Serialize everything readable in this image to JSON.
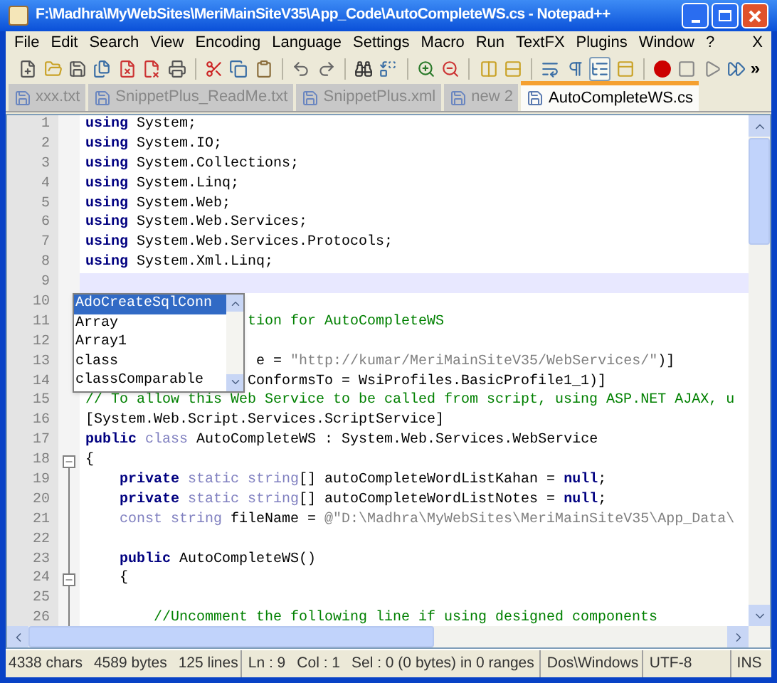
{
  "window": {
    "title": "F:\\Madhra\\MyWebSites\\MeriMainSiteV35\\App_Code\\AutoCompleteWS.cs - Notepad++"
  },
  "menu": {
    "items": [
      "File",
      "Edit",
      "Search",
      "View",
      "Encoding",
      "Language",
      "Settings",
      "Macro",
      "Run",
      "TextFX",
      "Plugins",
      "Window",
      "?"
    ],
    "close": "X"
  },
  "toolbar": {
    "buttons": [
      {
        "pressed": false
      },
      {
        "pressed": false
      },
      {
        "pressed": false
      },
      {
        "pressed": false
      },
      {
        "pressed": false
      },
      {
        "pressed": false
      },
      {
        "pressed": false
      },
      {
        "pressed": false
      },
      {
        "pressed": false
      },
      {
        "pressed": false
      },
      {
        "pressed": false
      },
      {
        "pressed": false
      },
      {
        "pressed": false
      },
      {
        "pressed": false
      },
      {
        "pressed": false
      },
      {
        "pressed": false
      },
      {
        "pressed": false
      },
      {
        "pressed": false
      },
      {
        "pressed": false
      },
      {
        "pressed": false
      },
      {
        "pressed": true
      },
      {
        "pressed": false
      },
      {
        "pressed": false
      },
      {
        "pressed": false
      },
      {
        "pressed": false
      },
      {
        "pressed": false
      }
    ],
    "overflow": "»"
  },
  "tabs": [
    {
      "label": "xxx.txt",
      "selected": false
    },
    {
      "label": "SnippetPlus_ReadMe.txt",
      "selected": false
    },
    {
      "label": "SnippetPlus.xml",
      "selected": false
    },
    {
      "label": "new  2",
      "selected": false
    },
    {
      "label": "AutoCompleteWS.cs",
      "selected": true
    }
  ],
  "editor": {
    "lines": [
      {
        "number": "1",
        "current": false,
        "fold_start": false,
        "segments": [
          {
            "kind": "keyword",
            "text": "using"
          },
          {
            "kind": "plain",
            "text": " System;"
          }
        ]
      },
      {
        "number": "2",
        "current": false,
        "fold_start": false,
        "segments": [
          {
            "kind": "keyword",
            "text": "using"
          },
          {
            "kind": "plain",
            "text": " System.IO;"
          }
        ]
      },
      {
        "number": "3",
        "current": false,
        "fold_start": false,
        "segments": [
          {
            "kind": "keyword",
            "text": "using"
          },
          {
            "kind": "plain",
            "text": " System.Collections;"
          }
        ]
      },
      {
        "number": "4",
        "current": false,
        "fold_start": false,
        "segments": [
          {
            "kind": "keyword",
            "text": "using"
          },
          {
            "kind": "plain",
            "text": " System.Linq;"
          }
        ]
      },
      {
        "number": "5",
        "current": false,
        "fold_start": false,
        "segments": [
          {
            "kind": "keyword",
            "text": "using"
          },
          {
            "kind": "plain",
            "text": " System.Web;"
          }
        ]
      },
      {
        "number": "6",
        "current": false,
        "fold_start": false,
        "segments": [
          {
            "kind": "keyword",
            "text": "using"
          },
          {
            "kind": "plain",
            "text": " System.Web.Services;"
          }
        ]
      },
      {
        "number": "7",
        "current": false,
        "fold_start": false,
        "segments": [
          {
            "kind": "keyword",
            "text": "using"
          },
          {
            "kind": "plain",
            "text": " System.Web.Services.Protocols;"
          }
        ]
      },
      {
        "number": "8",
        "current": false,
        "fold_start": false,
        "segments": [
          {
            "kind": "keyword",
            "text": "using"
          },
          {
            "kind": "plain",
            "text": " System.Xml.Linq;"
          }
        ]
      },
      {
        "number": "9",
        "current": true,
        "fold_start": false
      },
      {
        "number": "10",
        "current": false,
        "fold_start": false
      },
      {
        "number": "11",
        "current": false,
        "fold_start": false,
        "segments": [
          {
            "kind": "comment",
            "text": "                   tion for AutoCompleteWS"
          }
        ]
      },
      {
        "number": "12",
        "current": false,
        "fold_start": false
      },
      {
        "number": "13",
        "current": false,
        "fold_start": false,
        "segments": [
          {
            "kind": "plain",
            "text": "                    e = "
          },
          {
            "kind": "string",
            "text": "\"http://kumar/MeriMainSiteV35/WebServices/\""
          },
          {
            "kind": "plain",
            "text": ")]"
          }
        ]
      },
      {
        "number": "14",
        "current": false,
        "fold_start": false,
        "segments": [
          {
            "kind": "plain",
            "text": "                   ConformsTo = WsiProfiles.BasicProfile1_1)]"
          }
        ]
      },
      {
        "number": "15",
        "current": false,
        "fold_start": false,
        "segments": [
          {
            "kind": "comment",
            "text": "// To allow this Web Service to be called from script, using ASP.NET AJAX, u"
          }
        ]
      },
      {
        "number": "16",
        "current": false,
        "fold_start": false,
        "segments": [
          {
            "kind": "plain",
            "text": "[System.Web.Script.Services.ScriptService]"
          }
        ]
      },
      {
        "number": "17",
        "current": false,
        "fold_start": false,
        "segments": [
          {
            "kind": "keyword",
            "text": "public"
          },
          {
            "kind": "type",
            "text": " class"
          },
          {
            "kind": "plain",
            "text": " AutoCompleteWS : System.Web.Services.WebService"
          }
        ]
      },
      {
        "number": "18",
        "current": false,
        "fold_start": true,
        "segments": [
          {
            "kind": "plain",
            "text": "{"
          }
        ]
      },
      {
        "number": "19",
        "current": false,
        "fold_start": false,
        "segments": [
          {
            "kind": "keyword",
            "text": "    private"
          },
          {
            "kind": "type",
            "text": " static string"
          },
          {
            "kind": "plain",
            "text": "[] autoCompleteWordListKahan = "
          },
          {
            "kind": "keyword",
            "text": "null"
          },
          {
            "kind": "plain",
            "text": ";"
          }
        ]
      },
      {
        "number": "20",
        "current": false,
        "fold_start": false,
        "segments": [
          {
            "kind": "keyword",
            "text": "    private"
          },
          {
            "kind": "type",
            "text": " static string"
          },
          {
            "kind": "plain",
            "text": "[] autoCompleteWordListNotes = "
          },
          {
            "kind": "keyword",
            "text": "null"
          },
          {
            "kind": "plain",
            "text": ";"
          }
        ]
      },
      {
        "number": "21",
        "current": false,
        "fold_start": false,
        "segments": [
          {
            "kind": "type",
            "text": "    const string"
          },
          {
            "kind": "plain",
            "text": " fileName = "
          },
          {
            "kind": "string",
            "text": "@\"D:\\Madhra\\MyWebSites\\MeriMainSiteV35\\App_Data\\"
          }
        ]
      },
      {
        "number": "22",
        "current": false,
        "fold_start": false
      },
      {
        "number": "23",
        "current": false,
        "fold_start": false,
        "segments": [
          {
            "kind": "keyword",
            "text": "    public"
          },
          {
            "kind": "plain",
            "text": " AutoCompleteWS()"
          }
        ]
      },
      {
        "number": "24",
        "current": false,
        "fold_start": true,
        "segments": [
          {
            "kind": "plain",
            "text": "    {"
          }
        ]
      },
      {
        "number": "25",
        "current": false,
        "fold_start": false
      },
      {
        "number": "26",
        "current": false,
        "fold_start": false,
        "segments": [
          {
            "kind": "comment",
            "text": "        //Uncomment the following line if using designed components"
          }
        ]
      }
    ]
  },
  "autocomplete": {
    "items": [
      {
        "label": "AdoCreateSqlConn",
        "selected": true
      },
      {
        "label": "Array",
        "selected": false
      },
      {
        "label": "Array1",
        "selected": false
      },
      {
        "label": "class",
        "selected": false
      },
      {
        "label": "classComparable",
        "selected": false
      }
    ]
  },
  "status_bar": {
    "counts": [
      "4338 chars",
      "4589 bytes",
      "125 lines"
    ],
    "position": [
      "Ln : 9",
      "Col : 1",
      "Sel : 0 (0 bytes) in 0 ranges"
    ],
    "eol": "Dos\\Windows",
    "encoding": "UTF-8",
    "mode": "INS"
  }
}
